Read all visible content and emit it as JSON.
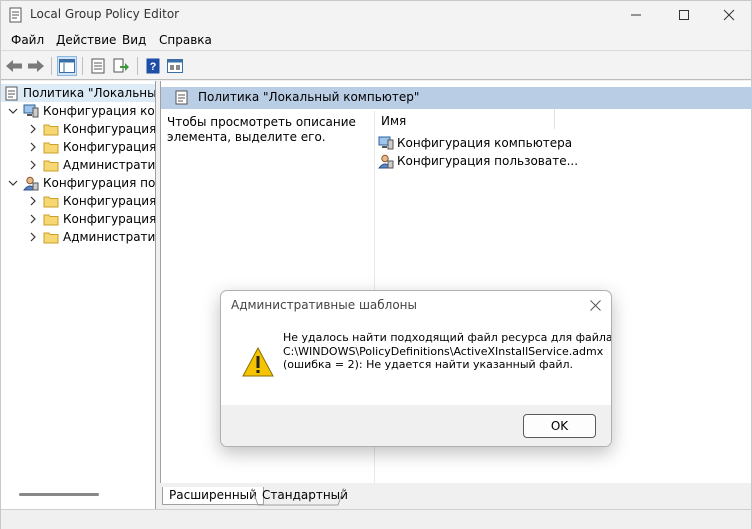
{
  "window": {
    "title": "Local Group Policy Editor"
  },
  "menu": [
    "Файл",
    "Действие",
    "Вид",
    "Справка"
  ],
  "tree": {
    "root": "Политика \"Локальный компьютер\"",
    "computer_config": "Конфигурация компьютера",
    "computer_children": [
      "Конфигурация программ",
      "Конфигурация Windows",
      "Административные шаблоны"
    ],
    "user_config": "Конфигурация пользователя",
    "user_children": [
      "Конфигурация программ",
      "Конфигурация Windows",
      "Административные шаблоны"
    ]
  },
  "right": {
    "header": "Политика \"Локальный компьютер\"",
    "description": "Чтобы просмотреть описание элемента, выделите его.",
    "column_name": "Имя",
    "items": [
      "Конфигурация компьютера",
      "Конфигурация пользовате..."
    ]
  },
  "tabs": {
    "extended": "Расширенный",
    "standard": "Стандартный"
  },
  "dialog": {
    "title": "Административные шаблоны",
    "message_lines": [
      "Не удалось найти подходящий файл ресурса для файла",
      "C:\\WINDOWS\\PolicyDefinitions\\ActiveXInstallService.admx",
      "(ошибка = 2): Не удается найти указанный файл."
    ],
    "ok_label": "OK"
  },
  "colors": {
    "selection": "#ddebf7",
    "header": "#b9cde5",
    "warning": "#f5c400"
  }
}
